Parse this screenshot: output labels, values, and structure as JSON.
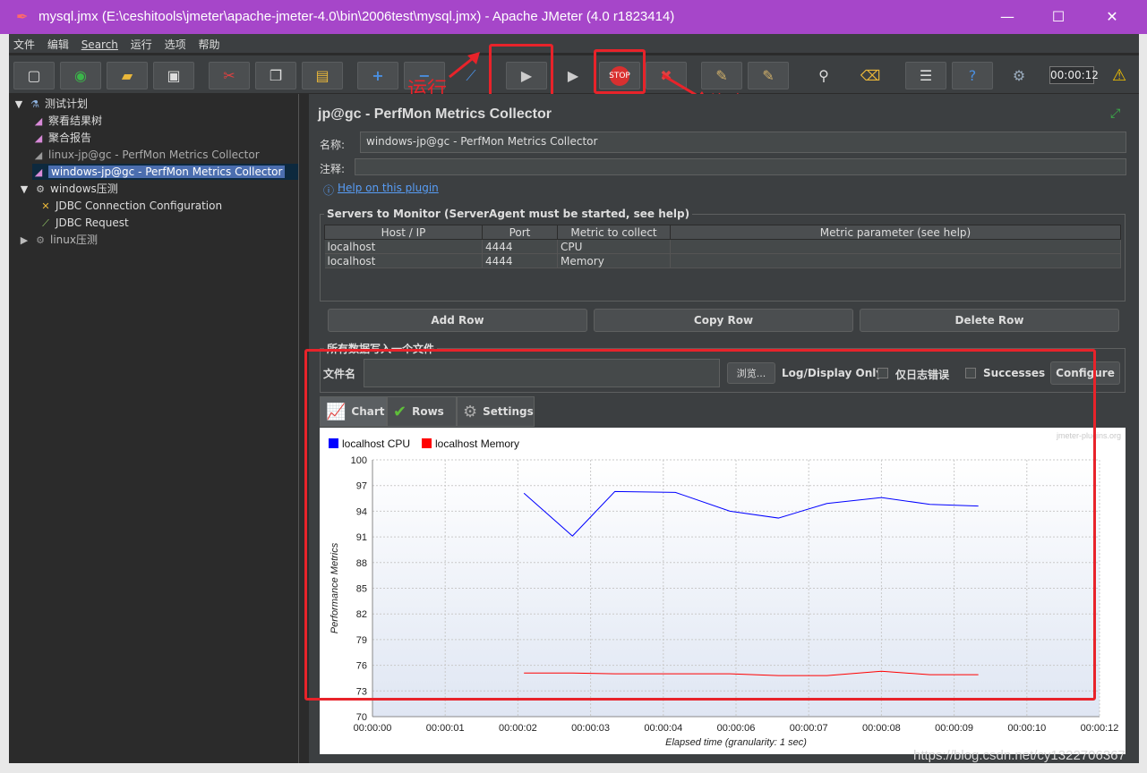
{
  "window": {
    "title": "mysql.jmx (E:\\ceshitools\\jmeter\\apache-jmeter-4.0\\bin\\2006test\\mysql.jmx) - Apache JMeter (4.0 r1823414)",
    "minimize": "—",
    "maximize": "☐",
    "close": "✕"
  },
  "menu": [
    "文件",
    "编辑",
    "Search",
    "运行",
    "选项",
    "帮助"
  ],
  "toolbar": {
    "timer": "00:00:12"
  },
  "annotations": {
    "run": "运行",
    "stop": "停止"
  },
  "tree": {
    "items": [
      {
        "label": "测试计划",
        "icon": "flask-icon"
      },
      {
        "label": "察看结果树",
        "icon": "chart-icon"
      },
      {
        "label": "聚合报告",
        "icon": "chart-icon"
      },
      {
        "label": "linux-jp@gc - PerfMon Metrics Collector",
        "icon": "chart-icon"
      },
      {
        "label": "windows-jp@gc - PerfMon Metrics Collector",
        "icon": "chart-icon"
      },
      {
        "label": "windows压测",
        "icon": "gear-icon"
      },
      {
        "label": "JDBC Connection Configuration",
        "icon": "wrench-icon"
      },
      {
        "label": "JDBC Request",
        "icon": "pen-icon"
      },
      {
        "label": "linux压测",
        "icon": "gear-icon"
      }
    ]
  },
  "panel": {
    "title": "jp@gc - PerfMon Metrics Collector",
    "name_label": "名称:",
    "name_value": "windows-jp@gc - PerfMon Metrics Collector",
    "comment_label": "注释:",
    "comment_value": "",
    "help_link": "Help on this plugin",
    "servers_title": "Servers to Monitor (ServerAgent must be started, see help)",
    "columns": [
      "Host / IP",
      "Port",
      "Metric to collect",
      "Metric parameter (see help)"
    ],
    "rows": [
      [
        "localhost",
        "4444",
        "CPU",
        ""
      ],
      [
        "localhost",
        "4444",
        "Memory",
        ""
      ]
    ],
    "add_row": "Add Row",
    "copy_row": "Copy Row",
    "delete_row": "Delete Row",
    "file_section_title": "所有数据写入一个文件",
    "file_label": "文件名",
    "file_value": "",
    "browse": "浏览...",
    "log_display": "Log/Display Only:",
    "errors_only": "仅日志错误",
    "successes": "Successes",
    "configure": "Configure",
    "tabs": [
      "Chart",
      "Rows",
      "Settings"
    ]
  },
  "chart_data": {
    "type": "line",
    "watermark": "jmeter-plugins.org",
    "xlabel": "Elapsed time (granularity: 1 sec)",
    "ylabel": "Performance Metrics",
    "ylim": [
      70,
      100
    ],
    "yticks": [
      "100",
      "97",
      "94",
      "91",
      "88",
      "85",
      "82",
      "79",
      "76",
      "73",
      "70"
    ],
    "xticks": [
      "00:00:00",
      "00:00:01",
      "00:00:02",
      "00:00:03",
      "00:00:04",
      "00:00:06",
      "00:00:07",
      "00:00:08",
      "00:00:09",
      "00:00:10",
      "00:00:12"
    ],
    "grid": true,
    "legend_position": "top-left",
    "series": [
      {
        "name": "localhost CPU",
        "color": "#0000ff",
        "x": [
          2.5,
          3.3,
          4.0,
          5.0,
          5.9,
          6.7,
          7.5,
          8.4,
          9.2,
          10.0
        ],
        "values": [
          96.1,
          91.1,
          96.3,
          96.2,
          94.0,
          93.2,
          94.9,
          95.6,
          94.8,
          94.6
        ]
      },
      {
        "name": "localhost Memory",
        "color": "#ff0000",
        "x": [
          2.5,
          3.3,
          4.0,
          5.0,
          5.9,
          6.7,
          7.5,
          8.4,
          9.2,
          10.0
        ],
        "values": [
          75.1,
          75.1,
          75.0,
          75.0,
          75.0,
          74.8,
          74.8,
          75.3,
          74.9,
          74.9
        ]
      }
    ]
  },
  "watermark": "https://blog.csdn.net/cy1322706367"
}
